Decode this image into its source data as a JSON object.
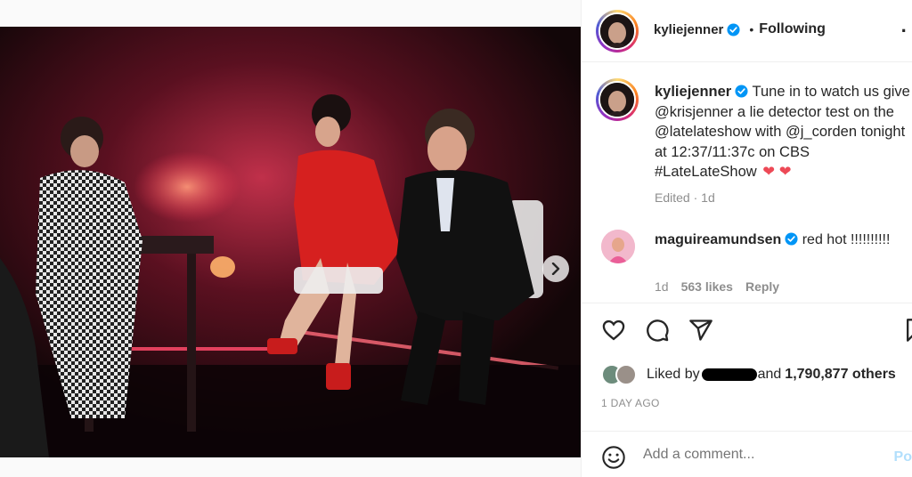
{
  "colors": {
    "text": "#262626",
    "muted": "#8e8e8e",
    "verified": "#0095f6",
    "heart": "#ed4956",
    "post_disabled": "#b2dffc"
  },
  "header": {
    "username": "kyliejenner",
    "separator": "•",
    "following_label": "Following",
    "more_icon": "more-icon"
  },
  "caption": {
    "username": "kyliejenner",
    "text": "Tune in to watch us give @krisjenner a lie detector test on the @latelateshow with @j_corden tonight at 12:37/11:37c on CBS #LateLateShow",
    "hearts": "❤ ❤",
    "edited": "Edited",
    "dot": "·",
    "time": "1d"
  },
  "comment": {
    "username": "maguireamundsen",
    "text": "red hot !!!!!!!!!!",
    "time": "1d",
    "likes": "563 likes",
    "reply_label": "Reply"
  },
  "actions": {
    "like_icon": "heart-icon",
    "comment_icon": "comment-icon",
    "share_icon": "share-icon",
    "save_icon": "bookmark-icon"
  },
  "likes": {
    "prefix": "Liked by",
    "middle": "and",
    "count": "1,790,877 others"
  },
  "timestamp": "1 DAY AGO",
  "add_comment": {
    "placeholder": "Add a comment...",
    "post_label": "Po",
    "emoji_icon": "emoji-icon"
  },
  "carousel": {
    "slide_count": 2,
    "active_index": 0,
    "next_icon": "chevron-right-icon"
  }
}
